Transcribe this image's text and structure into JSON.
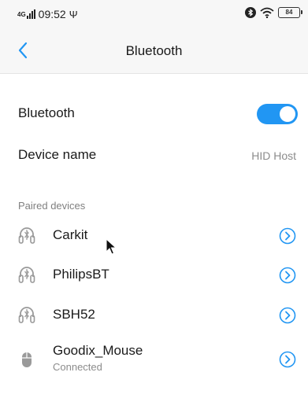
{
  "status_bar": {
    "network": "4G",
    "time": "09:52",
    "usb_symbol": "Ψ",
    "battery": "84"
  },
  "header": {
    "title": "Bluetooth"
  },
  "settings": {
    "bluetooth_label": "Bluetooth",
    "bluetooth_on": true,
    "device_name_label": "Device name",
    "device_name_value": "HID Host"
  },
  "paired": {
    "section_label": "Paired devices",
    "devices": [
      {
        "name": "Carkit",
        "icon": "headset-icon",
        "status": ""
      },
      {
        "name": "PhilipsBT",
        "icon": "headset-icon",
        "status": ""
      },
      {
        "name": "SBH52",
        "icon": "headset-icon",
        "status": ""
      },
      {
        "name": "Goodix_Mouse",
        "icon": "mouse-icon",
        "status": "Connected"
      }
    ]
  },
  "colors": {
    "accent": "#2196f3",
    "secondary_text": "#8c8c8c",
    "header_bg": "#f7f7f7"
  }
}
